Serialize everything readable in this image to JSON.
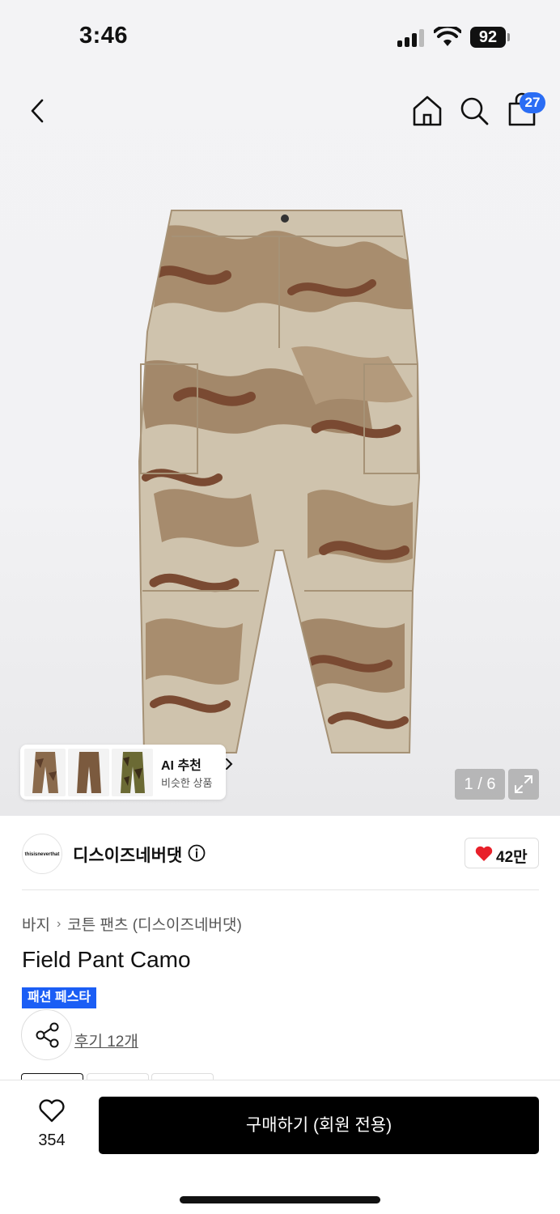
{
  "status_bar": {
    "time": "3:46",
    "battery": "92"
  },
  "header": {
    "back_icon": "chevron-left-icon",
    "home_icon": "home-icon",
    "search_icon": "search-icon",
    "cart_icon": "shopping-bag-icon",
    "cart_count": "27"
  },
  "gallery": {
    "ai_recommend": {
      "title": "AI 추천",
      "subtitle": "비슷한 상품"
    },
    "page_current": "1",
    "page_separator": " / ",
    "page_total": "6",
    "expand_icon": "expand-icon"
  },
  "brand": {
    "logo_text": "thisisneverthat",
    "name": "디스이즈네버댓",
    "info_icon": "info-circle-icon",
    "like_count": "42만"
  },
  "product": {
    "breadcrumb": [
      "바지",
      "코튼 팬츠 (디스이즈네버댓)"
    ],
    "title": "Field Pant Camo",
    "promo_badge": "패션 페스타",
    "review_link": "후기 12개"
  },
  "bottom_bar": {
    "wish_count": "354",
    "buy_label": "구매하기 (회원 전용)"
  },
  "colors": {
    "accent_blue": "#1b5ef5",
    "badge_blue": "#2a6df4",
    "heart_red": "#e8202a",
    "buy_button": "#000000"
  }
}
